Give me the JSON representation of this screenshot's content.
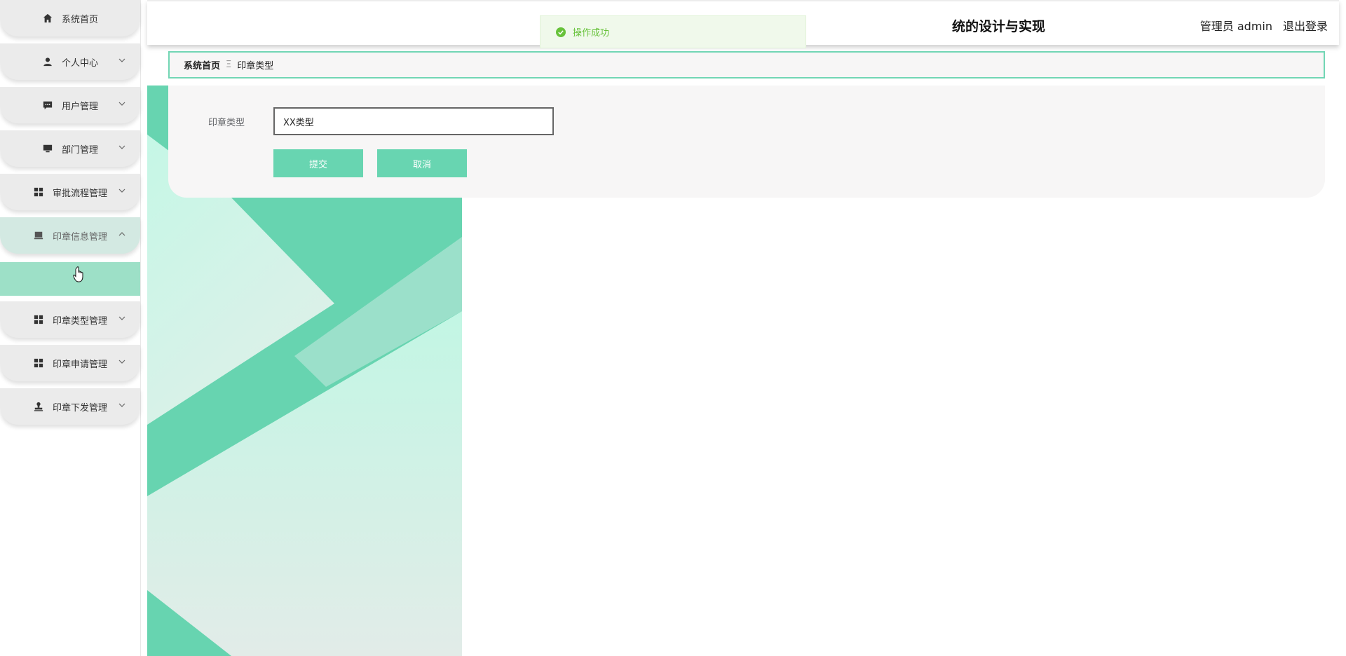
{
  "sidebar": {
    "items": [
      {
        "label": "系统首页",
        "icon": "home-icon"
      },
      {
        "label": "个人中心",
        "icon": "user-icon"
      },
      {
        "label": "用户管理",
        "icon": "chat-icon"
      },
      {
        "label": "部门管理",
        "icon": "monitor-icon"
      },
      {
        "label": "审批流程管理",
        "icon": "grid-icon"
      },
      {
        "label": "印章信息管理",
        "icon": "box-icon"
      },
      {
        "label": "印章类型管理",
        "icon": "grid-icon"
      },
      {
        "label": "印章申请管理",
        "icon": "grid-icon"
      },
      {
        "label": "印章下发管理",
        "icon": "stamp-icon"
      }
    ]
  },
  "header": {
    "title": "统的设计与实现",
    "user": "管理员 admin",
    "logout": "退出登录"
  },
  "toast": {
    "message": "操作成功"
  },
  "breadcrumb": {
    "home": "系统首页",
    "separator": "Ξ",
    "current": "印章类型"
  },
  "form": {
    "field_label": "印章类型",
    "field_value": "XX类型",
    "submit_label": "提交",
    "cancel_label": "取消"
  },
  "colors": {
    "accent": "#68d5b1",
    "active_sub": "#9de0c7",
    "success": "#67c23a"
  }
}
